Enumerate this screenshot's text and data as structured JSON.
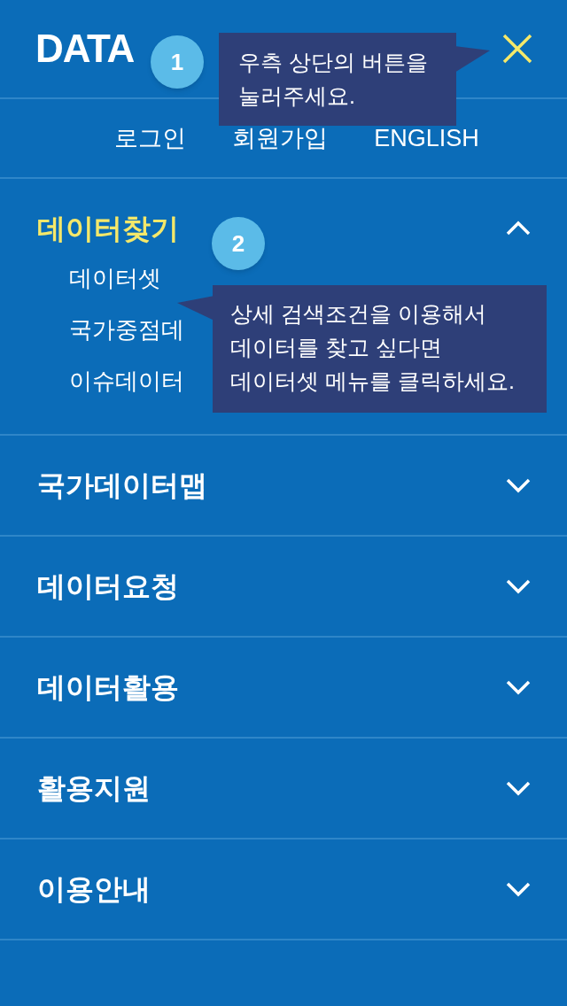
{
  "logo": "DATA",
  "links": [
    "로그인",
    "회원가입",
    "ENGLISH"
  ],
  "menu": [
    {
      "label": "데이터찾기",
      "expanded": true,
      "children": [
        "데이터셋",
        "국가중점데",
        "이슈데이터"
      ]
    },
    {
      "label": "국가데이터맵",
      "expanded": false
    },
    {
      "label": "데이터요청",
      "expanded": false
    },
    {
      "label": "데이터활용",
      "expanded": false
    },
    {
      "label": "활용지원",
      "expanded": false
    },
    {
      "label": "이용안내",
      "expanded": false
    }
  ],
  "coach_marks": [
    {
      "number": "1",
      "text": "우측 상단의 버튼을\n눌러주세요."
    },
    {
      "number": "2",
      "text": "상세 검색조건을 이용해서\n데이터를 찾고 싶다면\n데이터셋 메뉴를 클릭하세요."
    }
  ]
}
